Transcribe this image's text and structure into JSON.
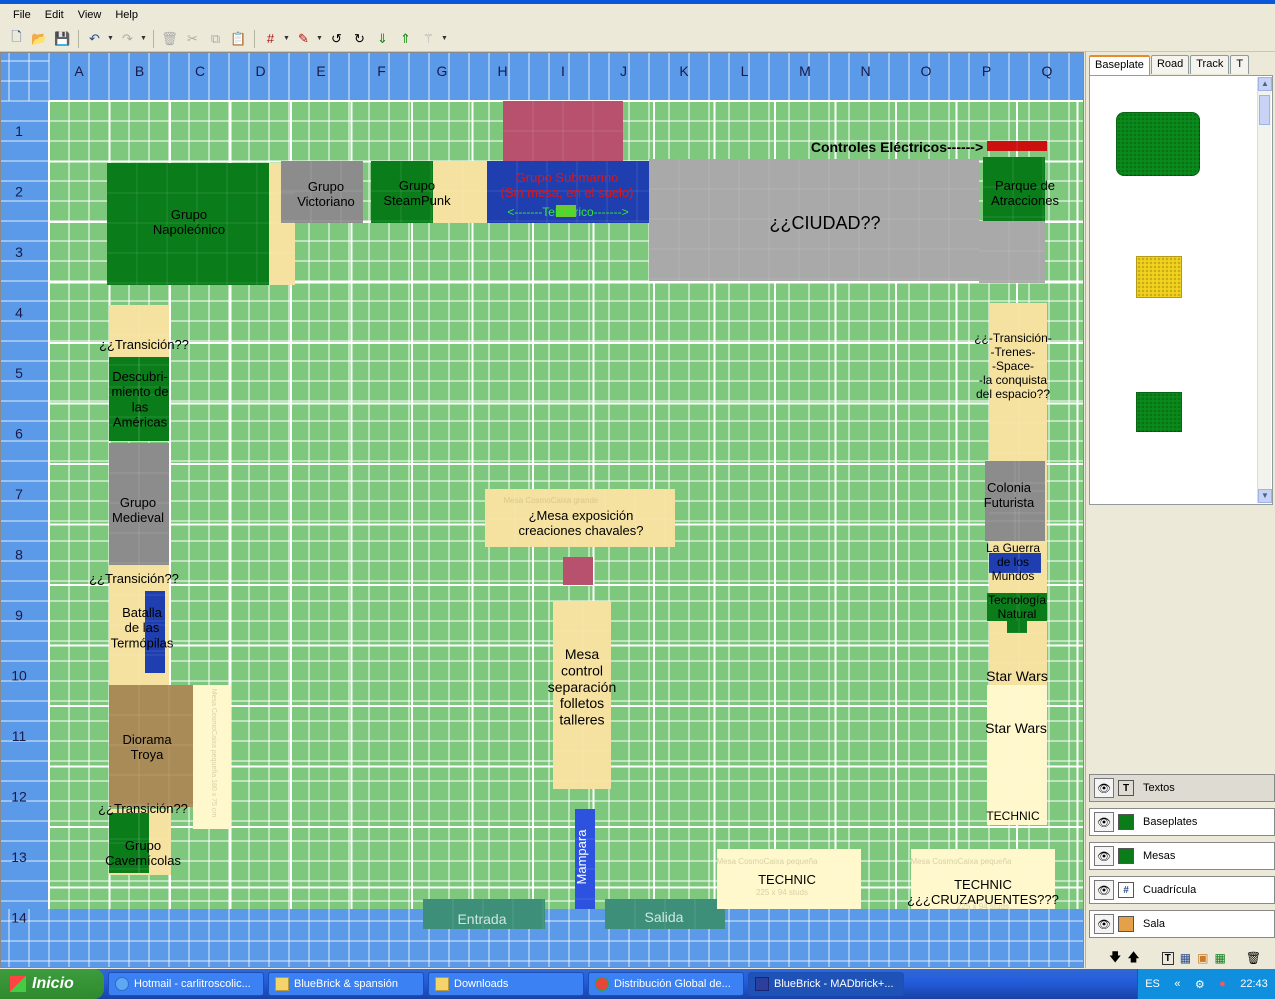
{
  "menu": [
    "File",
    "Edit",
    "View",
    "Help"
  ],
  "toolbar": {
    "new_icon": "new-file-icon",
    "open_icon": "open-folder-icon",
    "save_icon": "save-icon",
    "undo_icon": "undo-icon",
    "redo_icon": "redo-icon",
    "delete_icon": "delete-icon",
    "cut_icon": "cut-icon",
    "copy_icon": "copy-icon",
    "paste_icon": "paste-icon",
    "snap_icon": "snap-grid-icon",
    "paint_icon": "paint-icon",
    "rotate_left_icon": "rotate-left-icon",
    "rotate_right_icon": "rotate-right-icon",
    "send_back_icon": "send-back-icon",
    "bring_front_icon": "bring-front-icon",
    "wand_icon": "magic-wand-icon"
  },
  "grid": {
    "columns": [
      "A",
      "B",
      "C",
      "D",
      "E",
      "F",
      "G",
      "H",
      "I",
      "J",
      "K",
      "L",
      "M",
      "N",
      "O",
      "P",
      "Q"
    ],
    "rows": [
      "1",
      "2",
      "3",
      "4",
      "5",
      "6",
      "7",
      "8",
      "9",
      "10",
      "11",
      "12",
      "13",
      "14"
    ]
  },
  "colors": {
    "baseplate_green": "#7ec87e",
    "grid_line": "#ffffff",
    "label_bar": "#5b9ae8",
    "table_cream": "#f5e2a0",
    "dark_green": "#0a7d1a",
    "city_gray": "#a9a9a9",
    "group_gray": "#8c8c8c",
    "navy": "#1f3fb0",
    "magenta": "#b8516e",
    "brown": "#a98b57",
    "teal": "#3d8f7a"
  },
  "map": {
    "napoleonico": "Grupo\nNapoleónico",
    "victoriano": "Grupo\nVictoriano",
    "steampunk": "Grupo\nSteamPunk",
    "submarino": "Grupo Submarino\n(Sin mesa, en el suelo)",
    "teleferico": "<-------Teleférico------->",
    "controles": "Controles Eléctricos------>",
    "parque": "Parque de\nAtracciones",
    "ciudad": "¿¿CIUDAD??",
    "transicion_1": "¿¿Transición??",
    "descubrimiento": "Descubri-\nmiento de\nlas\nAméricas",
    "medieval": "Grupo\nMedieval",
    "transicion_2": "¿¿Transición??",
    "termopilas": "Batalla\nde las\nTermópilas",
    "troya": "Diorama\nTroya",
    "transicion_3": "¿¿Transición??",
    "cavernicolas": "Grupo\nCavernícolas",
    "mesa_exposicion": "¿Mesa exposición\ncreaciones chavales?",
    "mesa_control": "Mesa\ncontrol\nseparación\nfolletos\ntalleres",
    "mampara": "Mampara",
    "entrada": "Entrada",
    "salida": "Salida",
    "transicion_space": "¿¿-Transición-\n-Trenes-\n-Space-\n-la conquista\ndel espacio??",
    "colonia": "Colonia\nFuturista",
    "guerra": "La Guerra\nde los\nMundos",
    "tecnologia": "Tecnología\nNatural",
    "starwars_1": "Star Wars",
    "starwars_2": "Star Wars",
    "technic_right": "TECHNIC",
    "technic_bottom": "TECHNIC",
    "technic_cruza": "TECHNIC\n¿¿¿CRUZAPUENTES???",
    "ghost_cosmo_grande": "Mesa CosmoCaixa grande",
    "ghost_cosmo_pequena_1": "Mesa CosmoCaixa pequeña",
    "ghost_cosmo_pequena_2": "Mesa CosmoCaixa pequeña",
    "ghost_studs_1": "225 x 94 studs",
    "ghost_studs_2": "225 x 94 studs",
    "ghost_vertical": "Mesa CosmoCaixa pequeña 180 x 75 cm"
  },
  "tabs": [
    "Baseplate",
    "Road",
    "Track",
    "T"
  ],
  "parts": [
    {
      "name": "green-baseplate-large",
      "color": "#0a8a1a"
    },
    {
      "name": "yellow-baseplate",
      "color": "#f2d21c"
    },
    {
      "name": "green-baseplate-small",
      "color": "#0a8a1a"
    }
  ],
  "layers": [
    {
      "name": "Textos",
      "icon": "text-layer-icon",
      "glyph": "T",
      "selected": true
    },
    {
      "name": "Baseplates",
      "icon": "baseplate-layer-icon",
      "glyph": "▦",
      "selected": false
    },
    {
      "name": "Mesas",
      "icon": "table-layer-icon",
      "glyph": "▦",
      "selected": false
    },
    {
      "name": "Cuadrícula",
      "icon": "grid-layer-icon",
      "glyph": "#",
      "selected": false
    },
    {
      "name": "Sala",
      "icon": "room-layer-icon",
      "glyph": "▣",
      "selected": false
    }
  ],
  "taskbar": {
    "start": "Inicio",
    "tasks": [
      {
        "label": "Hotmail - carlitroscolic...",
        "active": false
      },
      {
        "label": "BlueBrick & spansión",
        "active": false
      },
      {
        "label": "Downloads",
        "active": false
      },
      {
        "label": "Distribución Global de...",
        "active": false
      },
      {
        "label": "BlueBrick - MADbrick+...",
        "active": true
      }
    ],
    "lang": "ES",
    "clock": "22:43"
  }
}
